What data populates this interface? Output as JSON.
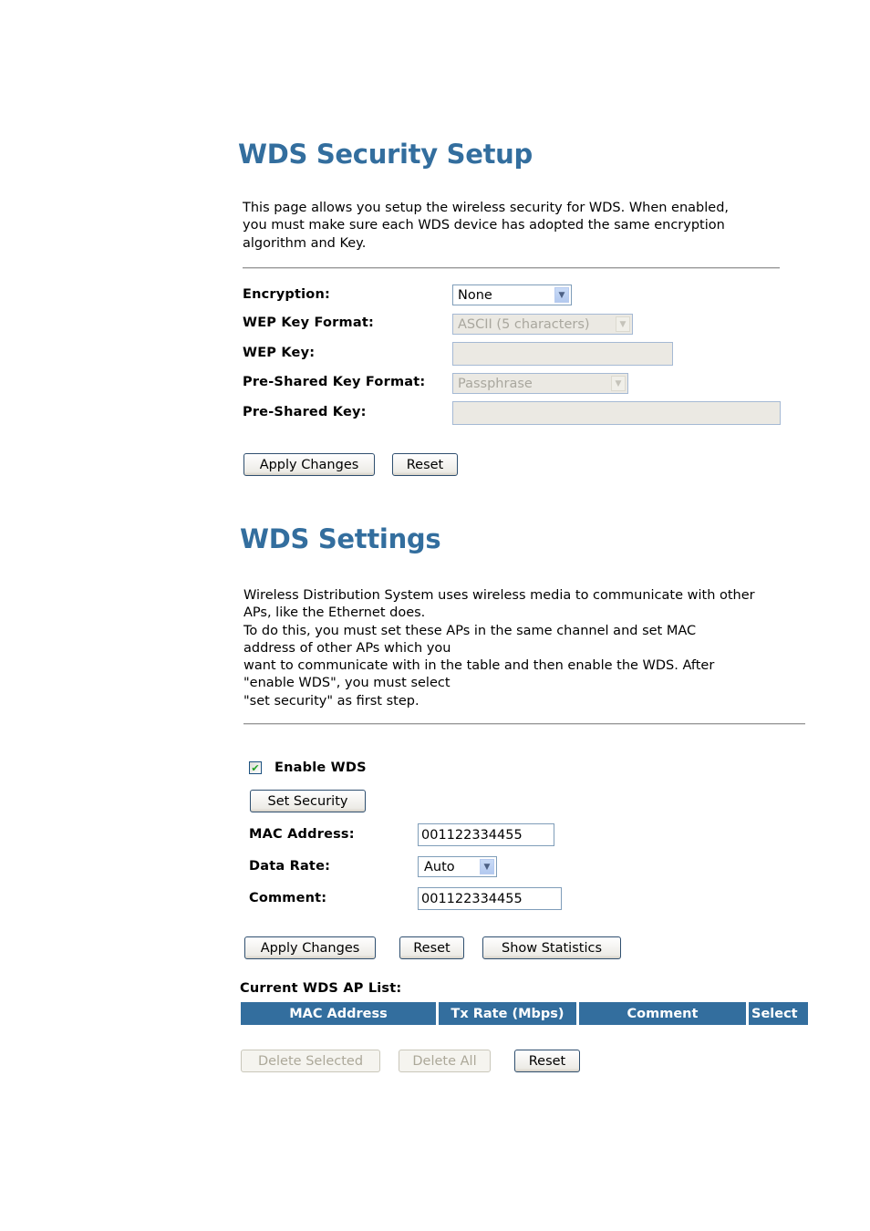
{
  "security_section": {
    "title": "WDS Security Setup",
    "description": [
      "This page allows you setup the wireless security for WDS. When enabled,",
      "you must make sure each WDS device has adopted the same encryption",
      "algorithm and Key."
    ],
    "fields": {
      "encryption": {
        "label": "Encryption:",
        "value": "None",
        "icon": "chevron-down-icon"
      },
      "wep_key_format": {
        "label": "WEP Key Format:",
        "value": "ASCII (5 characters)",
        "disabled": true
      },
      "wep_key": {
        "label": "WEP Key:",
        "value": "",
        "disabled": true
      },
      "psk_format": {
        "label": "Pre-Shared Key Format:",
        "value": "Passphrase",
        "disabled": true
      },
      "psk": {
        "label": "Pre-Shared Key:",
        "value": "",
        "disabled": true
      }
    },
    "buttons": {
      "apply": "Apply Changes",
      "reset": "Reset"
    }
  },
  "settings_section": {
    "title": "WDS Settings",
    "description": [
      "Wireless Distribution System uses wireless media to communicate with other",
      "APs, like the Ethernet does.",
      "To do this, you must set these APs in the same channel and set MAC",
      "address of other APs which you",
      "want to communicate with in the table and then enable the WDS. After",
      "\"enable WDS\", you must select",
      "\"set security\" as first step."
    ],
    "enable_wds": {
      "label": "Enable WDS",
      "checked": true,
      "check_glyph": "✔"
    },
    "set_security_button": "Set Security",
    "fields": {
      "mac_address": {
        "label": "MAC Address:",
        "value": "001122334455"
      },
      "data_rate": {
        "label": "Data Rate:",
        "value": "Auto"
      },
      "comment": {
        "label": "Comment:",
        "value": "001122334455"
      }
    },
    "buttons": {
      "apply": "Apply Changes",
      "reset": "Reset",
      "show_statistics": "Show Statistics"
    }
  },
  "ap_list": {
    "title": "Current WDS AP List:",
    "columns": [
      "MAC Address",
      "Tx Rate (Mbps)",
      "Comment",
      "Select"
    ],
    "rows": [],
    "buttons": {
      "delete_selected": "Delete Selected",
      "delete_all": "Delete All",
      "reset": "Reset"
    }
  },
  "colors": {
    "accent": "#336e9e",
    "input_border": "#7f9db9",
    "disabled_bg": "#ebe9e3"
  },
  "icons": {
    "dropdown_arrow": "⌄"
  }
}
